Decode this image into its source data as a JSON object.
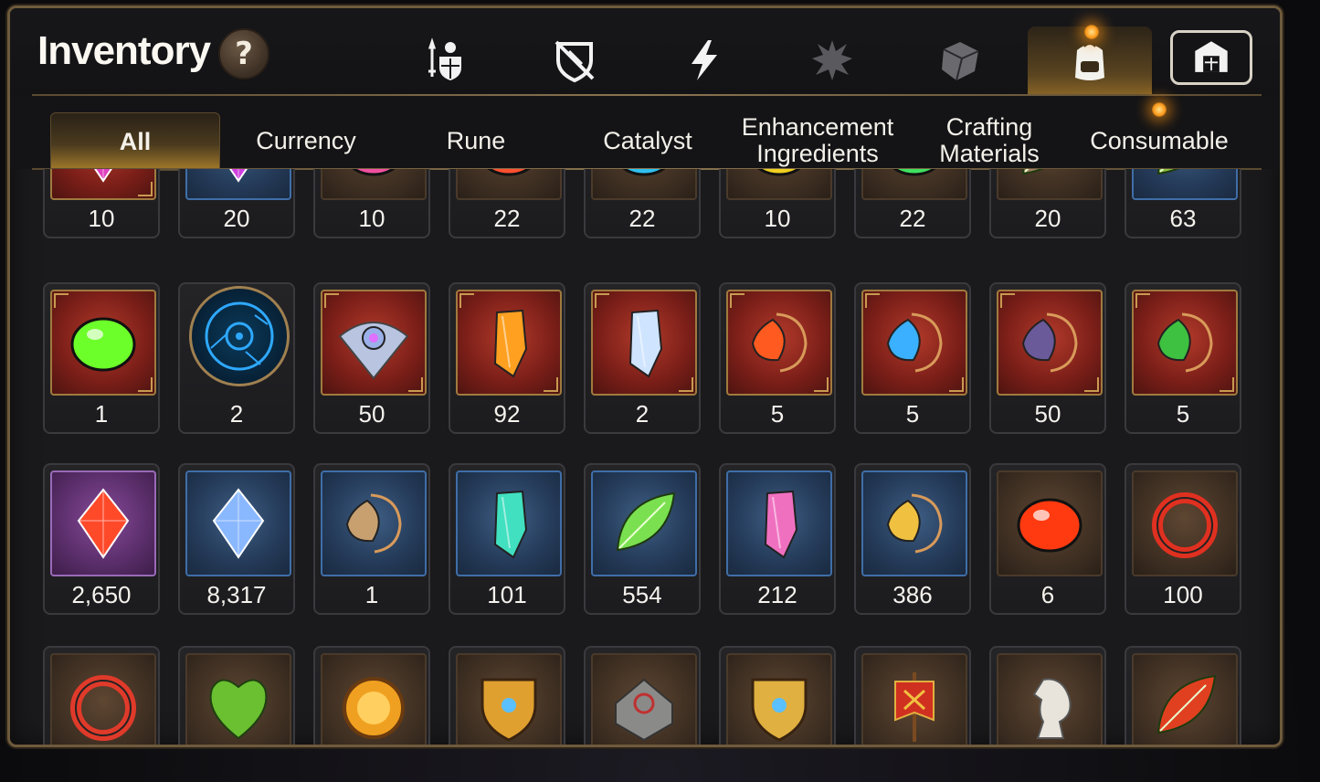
{
  "window": {
    "title": "Inventory",
    "help_symbol": "?"
  },
  "category_bar": [
    {
      "icon": "knight-shield-sword-icon",
      "active": false
    },
    {
      "icon": "broken-shield-icon",
      "active": false
    },
    {
      "icon": "lightning-icon",
      "active": false
    },
    {
      "icon": "splash-emblem-icon",
      "active": false
    },
    {
      "icon": "cube-icon",
      "active": false
    },
    {
      "icon": "backpack-icon",
      "active": true,
      "new": true
    },
    {
      "icon": "castle-gate-icon",
      "active": false
    }
  ],
  "tabs": [
    {
      "label": "All",
      "active": true
    },
    {
      "label": "Currency"
    },
    {
      "label": "Rune"
    },
    {
      "label": "Catalyst"
    },
    {
      "label": "Enhancement Ingredients",
      "lines": [
        "Enhancement",
        "Ingredients"
      ]
    },
    {
      "label": "Crafting Materials",
      "lines": [
        "Crafting",
        "Materials"
      ]
    },
    {
      "label": "Consumable",
      "new": true
    }
  ],
  "rows": [
    [
      {
        "count": "10",
        "bg": "red",
        "icon": "pink-gem-icon",
        "color": "#e040c0"
      },
      {
        "count": "20",
        "bg": "blue",
        "icon": "purple-gem-icon",
        "color": "#d040e0"
      },
      {
        "count": "10",
        "bg": "brown",
        "icon": "pink-stone-icon",
        "color": "#f050a0"
      },
      {
        "count": "22",
        "bg": "brown",
        "icon": "red-stone-icon",
        "color": "#ff5030"
      },
      {
        "count": "22",
        "bg": "brown",
        "icon": "blue-stone-icon",
        "color": "#30c0f0"
      },
      {
        "count": "10",
        "bg": "brown",
        "icon": "yellow-stone-icon",
        "color": "#f0d020"
      },
      {
        "count": "22",
        "bg": "brown",
        "icon": "green-stone-icon",
        "color": "#40e060"
      },
      {
        "count": "20",
        "bg": "brown",
        "icon": "claw-icon",
        "color": "#a08060"
      },
      {
        "count": "63",
        "bg": "blue",
        "icon": "leaf-branch-icon",
        "color": "#8ac040"
      }
    ],
    [
      {
        "count": "1",
        "bg": "red",
        "icon": "green-orb-icon",
        "color": "#6cff2a"
      },
      {
        "count": "2",
        "bg": "round",
        "icon": "blue-rune-disc-icon",
        "color": "#2ea8ff"
      },
      {
        "count": "50",
        "bg": "red",
        "icon": "eye-emblem-icon",
        "color": "#9ab0e8"
      },
      {
        "count": "92",
        "bg": "red",
        "icon": "amber-crystal-icon",
        "color": "#ffa020"
      },
      {
        "count": "2",
        "bg": "red",
        "icon": "triquetra-crystal-icon",
        "color": "#cfe4ff"
      },
      {
        "count": "5",
        "bg": "red",
        "icon": "fire-pendant-icon",
        "color": "#ff5a20"
      },
      {
        "count": "5",
        "bg": "red",
        "icon": "water-pendant-icon",
        "color": "#3ab0ff"
      },
      {
        "count": "50",
        "bg": "red",
        "icon": "dark-pendant-icon",
        "color": "#6a5a9a"
      },
      {
        "count": "5",
        "bg": "red",
        "icon": "clover-pendant-icon",
        "color": "#3ec040"
      }
    ],
    [
      {
        "count": "2,650",
        "bg": "purple",
        "icon": "ring-red-gem-icon",
        "color": "#ff4a2a"
      },
      {
        "count": "8,317",
        "bg": "blue",
        "icon": "blue-diamond-icon",
        "color": "#8ab8ff"
      },
      {
        "count": "1",
        "bg": "blue",
        "icon": "compass-key-icon",
        "color": "#c8a070"
      },
      {
        "count": "101",
        "bg": "blue",
        "icon": "teal-crystal-icon",
        "color": "#40e0c0"
      },
      {
        "count": "554",
        "bg": "blue",
        "icon": "green-leaf-icon",
        "color": "#7ae050"
      },
      {
        "count": "212",
        "bg": "blue",
        "icon": "pink-ore-icon",
        "color": "#f070c0"
      },
      {
        "count": "386",
        "bg": "blue",
        "icon": "star-amulet-icon",
        "color": "#f0c040"
      },
      {
        "count": "6",
        "bg": "brown",
        "icon": "lava-orb-icon",
        "color": "#ff3a10"
      },
      {
        "count": "100",
        "bg": "brown",
        "icon": "red-bracelet-icon",
        "color": "#e03020"
      }
    ],
    [
      {
        "count": "",
        "bg": "brown",
        "icon": "red-seal-icon",
        "color": "#e03a2a"
      },
      {
        "count": "",
        "bg": "brown",
        "icon": "green-heart-icon",
        "color": "#6ac030"
      },
      {
        "count": "",
        "bg": "brown",
        "icon": "gold-coin-icon",
        "color": "#f0a020"
      },
      {
        "count": "",
        "bg": "brown",
        "icon": "gold-crest-icon",
        "color": "#e0a030"
      },
      {
        "count": "",
        "bg": "brown",
        "icon": "stone-compass-icon",
        "color": "#8a8a88"
      },
      {
        "count": "",
        "bg": "brown",
        "icon": "fist-emblem-icon",
        "color": "#e0b040"
      },
      {
        "count": "",
        "bg": "brown",
        "icon": "red-banner-icon",
        "color": "#d03020"
      },
      {
        "count": "",
        "bg": "brown",
        "icon": "white-horse-icon",
        "color": "#e8e4dc"
      },
      {
        "count": "",
        "bg": "brown",
        "icon": "red-leaf-icon",
        "color": "#e04020"
      }
    ]
  ]
}
